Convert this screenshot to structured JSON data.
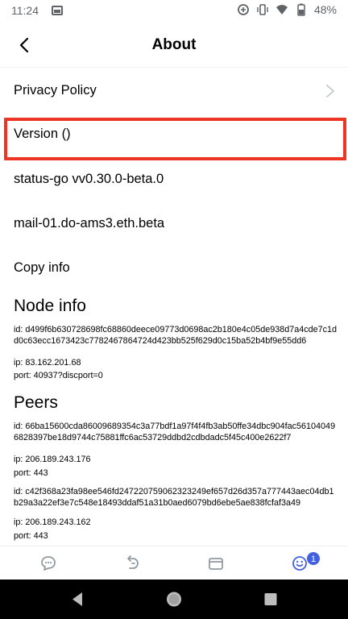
{
  "status_bar": {
    "time": "11:24",
    "battery": "48%"
  },
  "header": {
    "title": "About"
  },
  "menu": {
    "privacy_policy": "Privacy Policy",
    "version": "Version  ()",
    "status_go": "status-go vv0.30.0-beta.0",
    "mailserver": "mail-01.do-ams3.eth.beta",
    "copy_info": "Copy info"
  },
  "node_info": {
    "title": "Node info",
    "id": "id: d499f6b630728698fc68860deece09773d0698ac2b180e4c05de938d7a4cde7c1dd0c63ecc1673423c7782467864724d423bb525f629d0c15ba52b4bf9e55dd6",
    "ip": "ip: 83.162.201.68",
    "port": "port: 40937?discport=0"
  },
  "peers": {
    "title": "Peers",
    "list": [
      {
        "id": "id: 66ba15600cda86009689354c3a77bdf1a97f4f4fb3ab50ffe34dbc904fac561040496828397be18d9744c75881ffc6ac53729ddbd2cdbdadc5f45c400e2622f7",
        "ip": "ip: 206.189.243.176",
        "port": "port: 443"
      },
      {
        "id": "id: c42f368a23fa98ee546fd247220759062323249ef657d26d357a777443aec04db1b29a3a22ef3e7c548e18493ddaf51a31b0aed6079bd6ebe5ae838fcfaf3a49",
        "ip": "ip: 206.189.243.162",
        "port": "port: 443"
      }
    ]
  },
  "tabs": {
    "profile_badge": "1"
  },
  "colors": {
    "accent": "#4360df",
    "highlight": "#ee3524",
    "icon_gray": "#939ba1"
  },
  "icons": {
    "back": "arrow-left-icon",
    "chevron": "chevron-right-icon",
    "tab_chat": "chat-bubble-icon",
    "tab_browser": "dapp-browser-icon",
    "tab_wallet": "wallet-icon",
    "tab_profile": "profile-smile-icon"
  }
}
